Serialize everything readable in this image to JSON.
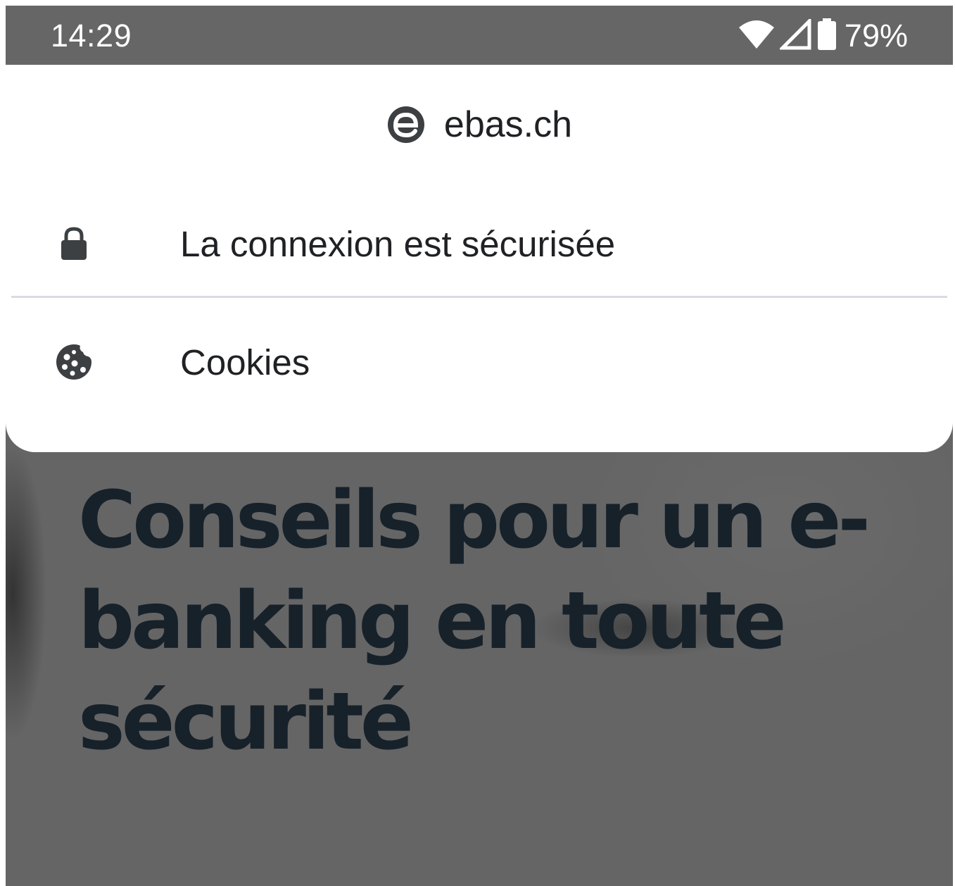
{
  "status_bar": {
    "time": "14:29",
    "battery": "79%",
    "icons": [
      "wifi-icon",
      "cell-signal-icon",
      "battery-icon"
    ]
  },
  "site_info": {
    "domain": "ebas.ch",
    "logo_icon": "ebas-logo-icon",
    "items": [
      {
        "label": "La connexion est sécurisée",
        "icon": "lock-icon"
      },
      {
        "label": "Cookies",
        "icon": "cookie-icon"
      }
    ]
  },
  "page": {
    "heading": "Conseils pour un e-banking en toute sécurité"
  },
  "colors": {
    "scrim": "#666666",
    "sheet": "#ffffff",
    "text": "#202124",
    "heading": "#17212a"
  }
}
